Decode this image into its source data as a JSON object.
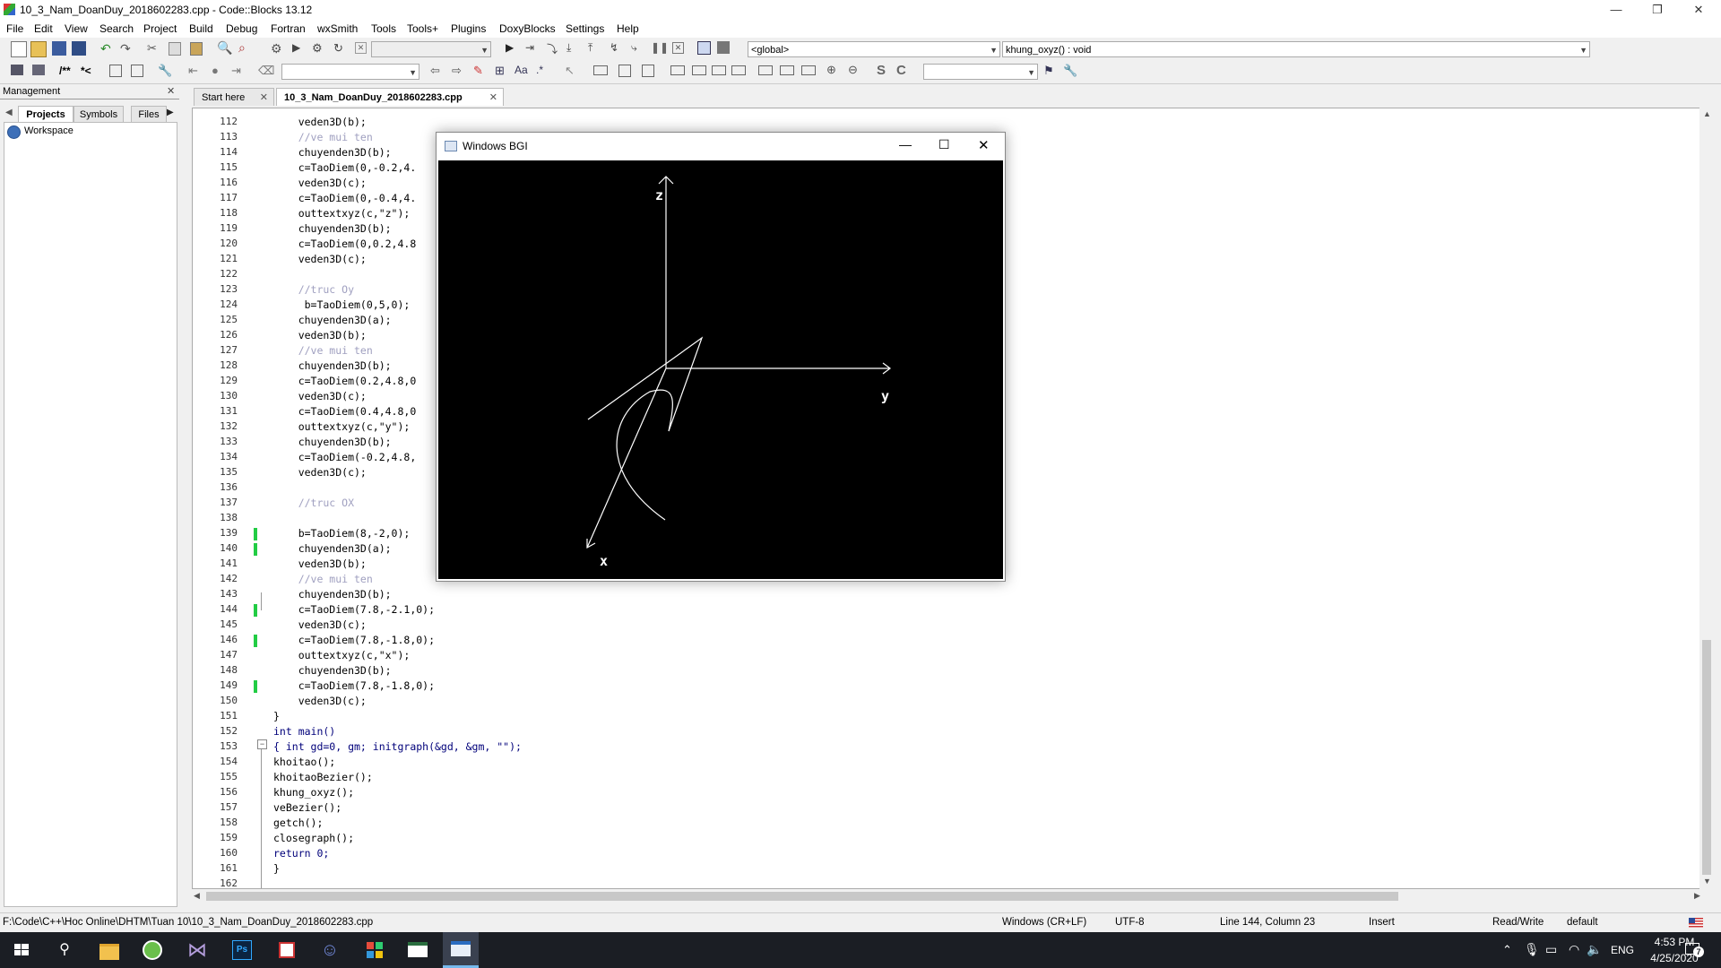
{
  "window": {
    "title": "10_3_Nam_DoanDuy_2018602283.cpp - Code::Blocks 13.12",
    "minimize": "—",
    "restore": "❐",
    "close": "✕"
  },
  "menu": [
    "File",
    "Edit",
    "View",
    "Search",
    "Project",
    "Build",
    "Debug",
    "Fortran",
    "wxSmith",
    "Tools",
    "Tools+",
    "Plugins",
    "DoxyBlocks",
    "Settings",
    "Help"
  ],
  "toolbar": {
    "scope_combo": "<global>",
    "function_combo": "khung_oxyz() : void",
    "doxy1": "/**",
    "doxy2": "*<"
  },
  "management": {
    "title": "Management",
    "tabs": [
      "Projects",
      "Symbols",
      "Files"
    ],
    "workspace": "Workspace"
  },
  "editor": {
    "tabs": [
      {
        "label": "Start here",
        "active": false
      },
      {
        "label": "10_3_Nam_DoanDuy_2018602283.cpp",
        "active": true
      }
    ],
    "lines": [
      {
        "n": "112",
        "text": "    veden3D(b);",
        "chg": false
      },
      {
        "n": "113",
        "text": "    //ve mui ten",
        "chg": false
      },
      {
        "n": "114",
        "text": "    chuyenden3D(b);",
        "chg": false
      },
      {
        "n": "115",
        "text": "    c=TaoDiem(0,-0.2,4.",
        "chg": false
      },
      {
        "n": "116",
        "text": "    veden3D(c);",
        "chg": false
      },
      {
        "n": "117",
        "text": "    c=TaoDiem(0,-0.4,4.",
        "chg": false
      },
      {
        "n": "118",
        "text": "    outtextxyz(c,\"z\");",
        "chg": false
      },
      {
        "n": "119",
        "text": "    chuyenden3D(b);",
        "chg": false
      },
      {
        "n": "120",
        "text": "    c=TaoDiem(0,0.2,4.8",
        "chg": false
      },
      {
        "n": "121",
        "text": "    veden3D(c);",
        "chg": false
      },
      {
        "n": "122",
        "text": "",
        "chg": false
      },
      {
        "n": "123",
        "text": "    //truc Oy",
        "chg": false
      },
      {
        "n": "124",
        "text": "     b=TaoDiem(0,5,0);",
        "chg": false
      },
      {
        "n": "125",
        "text": "    chuyenden3D(a);",
        "chg": false
      },
      {
        "n": "126",
        "text": "    veden3D(b);",
        "chg": false
      },
      {
        "n": "127",
        "text": "    //ve mui ten",
        "chg": false
      },
      {
        "n": "128",
        "text": "    chuyenden3D(b);",
        "chg": false
      },
      {
        "n": "129",
        "text": "    c=TaoDiem(0.2,4.8,0",
        "chg": false
      },
      {
        "n": "130",
        "text": "    veden3D(c);",
        "chg": false
      },
      {
        "n": "131",
        "text": "    c=TaoDiem(0.4,4.8,0",
        "chg": false
      },
      {
        "n": "132",
        "text": "    outtextxyz(c,\"y\");",
        "chg": false
      },
      {
        "n": "133",
        "text": "    chuyenden3D(b);",
        "chg": false
      },
      {
        "n": "134",
        "text": "    c=TaoDiem(-0.2,4.8,",
        "chg": false
      },
      {
        "n": "135",
        "text": "    veden3D(c);",
        "chg": false
      },
      {
        "n": "136",
        "text": "",
        "chg": false
      },
      {
        "n": "137",
        "text": "    //truc OX",
        "chg": false
      },
      {
        "n": "138",
        "text": "",
        "chg": false
      },
      {
        "n": "139",
        "text": "    b=TaoDiem(8,-2,0);",
        "chg": true
      },
      {
        "n": "140",
        "text": "    chuyenden3D(a);",
        "chg": true
      },
      {
        "n": "141",
        "text": "    veden3D(b);",
        "chg": false
      },
      {
        "n": "142",
        "text": "    //ve mui ten",
        "chg": false
      },
      {
        "n": "143",
        "text": "    chuyenden3D(b);",
        "chg": false
      },
      {
        "n": "144",
        "text": "    c=TaoDiem(7.8,-2.1,0);",
        "chg": true
      },
      {
        "n": "145",
        "text": "    veden3D(c);",
        "chg": false
      },
      {
        "n": "146",
        "text": "    c=TaoDiem(7.8,-1.8,0);",
        "chg": true
      },
      {
        "n": "147",
        "text": "    outtextxyz(c,\"x\");",
        "chg": false
      },
      {
        "n": "148",
        "text": "    chuyenden3D(b);",
        "chg": false
      },
      {
        "n": "149",
        "text": "    c=TaoDiem(7.8,-1.8,0);",
        "chg": true
      },
      {
        "n": "150",
        "text": "    veden3D(c);",
        "chg": false
      },
      {
        "n": "151",
        "text": "}",
        "chg": false
      },
      {
        "n": "152",
        "text": "int main()",
        "chg": false
      },
      {
        "n": "153",
        "text": "{ int gd=0, gm; initgraph(&gd, &gm, \"\");",
        "chg": false
      },
      {
        "n": "154",
        "text": "khoitao();",
        "chg": false
      },
      {
        "n": "155",
        "text": "khoitaoBezier();",
        "chg": false
      },
      {
        "n": "156",
        "text": "khung_oxyz();",
        "chg": false
      },
      {
        "n": "157",
        "text": "veBezier();",
        "chg": false
      },
      {
        "n": "158",
        "text": "getch();",
        "chg": false
      },
      {
        "n": "159",
        "text": "closegraph();",
        "chg": false
      },
      {
        "n": "160",
        "text": "return 0;",
        "chg": false
      },
      {
        "n": "161",
        "text": "}",
        "chg": false
      },
      {
        "n": "162",
        "text": "",
        "chg": false
      }
    ]
  },
  "bgi": {
    "title": "Windows BGI",
    "axis_labels": {
      "z": "z",
      "y": "y",
      "x": "x"
    }
  },
  "status": {
    "path": "F:\\Code\\C++\\Hoc Online\\DHTM\\Tuan 10\\10_3_Nam_DoanDuy_2018602283.cpp",
    "eol": "Windows (CR+LF)",
    "encoding": "UTF-8",
    "position": "Line 144, Column 23",
    "mode": "Insert",
    "access": "Read/Write",
    "lang": "default"
  },
  "taskbar": {
    "language": "ENG",
    "time": "4:53 PM",
    "date": "4/25/2020",
    "notification_count": "7"
  }
}
